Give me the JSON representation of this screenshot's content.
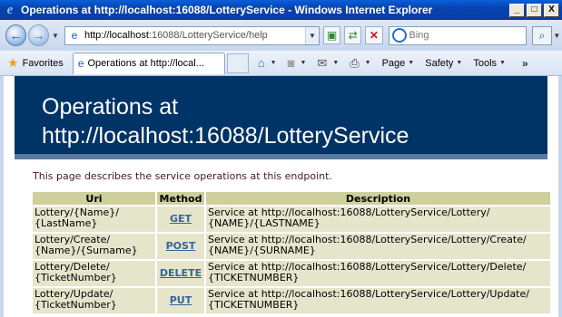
{
  "window": {
    "title": "Operations at http://localhost:16088/LotteryService - Windows Internet Explorer",
    "minimize": "_",
    "maximize": "□",
    "close": "X"
  },
  "navigation": {
    "address_host": "http://localhost",
    "address_rest": ":16088/LotteryService/help",
    "search_placeholder": "Bing"
  },
  "toolbar": {
    "favorites_label": "Favorites",
    "tab_title": "Operations at http://local...",
    "page_label": "Page",
    "safety_label": "Safety",
    "tools_label": "Tools"
  },
  "page": {
    "heading_line1": "Operations at",
    "heading_line2": "http://localhost:16088/LotteryService",
    "intro": "This page describes the service operations at this endpoint.",
    "table": {
      "headers": [
        "Uri",
        "Method",
        "Description"
      ],
      "rows": [
        {
          "uri_line1": "Lottery/{Name}/",
          "uri_line2": "{LastName}",
          "method": "GET",
          "desc_line1": "Service at http://localhost:16088/LotteryService/Lottery/",
          "desc_line2": "{NAME}/{LASTNAME}"
        },
        {
          "uri_line1": "Lottery/Create/",
          "uri_line2": "{Name}/{Surname}",
          "method": "POST",
          "desc_line1": "Service at http://localhost:16088/LotteryService/Lottery/Create/",
          "desc_line2": "{NAME}/{SURNAME}"
        },
        {
          "uri_line1": "Lottery/Delete/",
          "uri_line2": "{TicketNumber}",
          "method": "DELETE",
          "desc_line1": "Service at http://localhost:16088/LotteryService/Lottery/Delete/",
          "desc_line2": "{TICKETNUMBER}"
        },
        {
          "uri_line1": "Lottery/Update/",
          "uri_line2": "{TicketNumber}",
          "method": "PUT",
          "desc_line1": "Service at http://localhost:16088/LotteryService/Lottery/Update/",
          "desc_line2": "{TICKETNUMBER}"
        }
      ]
    }
  },
  "colors": {
    "banner": "#003366",
    "table_header": "#cecf9c",
    "table_cell": "#e5e5cc",
    "method_link": "#336699"
  }
}
